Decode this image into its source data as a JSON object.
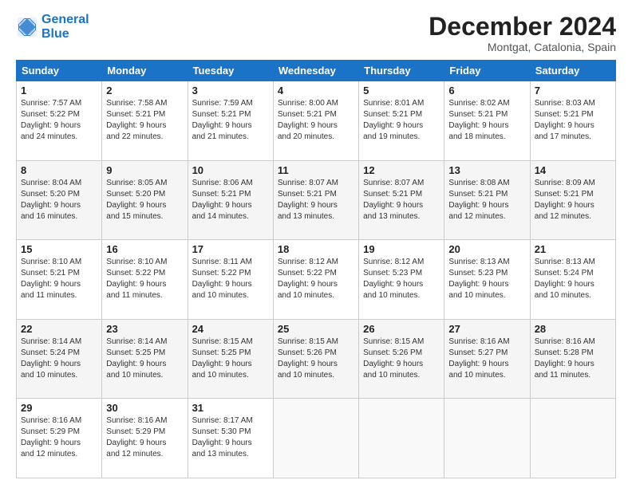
{
  "logo": {
    "line1": "General",
    "line2": "Blue"
  },
  "header": {
    "month": "December 2024",
    "location": "Montgat, Catalonia, Spain"
  },
  "days_of_week": [
    "Sunday",
    "Monday",
    "Tuesday",
    "Wednesday",
    "Thursday",
    "Friday",
    "Saturday"
  ],
  "weeks": [
    [
      {
        "day": "1",
        "info": "Sunrise: 7:57 AM\nSunset: 5:22 PM\nDaylight: 9 hours\nand 24 minutes."
      },
      {
        "day": "2",
        "info": "Sunrise: 7:58 AM\nSunset: 5:21 PM\nDaylight: 9 hours\nand 22 minutes."
      },
      {
        "day": "3",
        "info": "Sunrise: 7:59 AM\nSunset: 5:21 PM\nDaylight: 9 hours\nand 21 minutes."
      },
      {
        "day": "4",
        "info": "Sunrise: 8:00 AM\nSunset: 5:21 PM\nDaylight: 9 hours\nand 20 minutes."
      },
      {
        "day": "5",
        "info": "Sunrise: 8:01 AM\nSunset: 5:21 PM\nDaylight: 9 hours\nand 19 minutes."
      },
      {
        "day": "6",
        "info": "Sunrise: 8:02 AM\nSunset: 5:21 PM\nDaylight: 9 hours\nand 18 minutes."
      },
      {
        "day": "7",
        "info": "Sunrise: 8:03 AM\nSunset: 5:21 PM\nDaylight: 9 hours\nand 17 minutes."
      }
    ],
    [
      {
        "day": "8",
        "info": "Sunrise: 8:04 AM\nSunset: 5:20 PM\nDaylight: 9 hours\nand 16 minutes."
      },
      {
        "day": "9",
        "info": "Sunrise: 8:05 AM\nSunset: 5:20 PM\nDaylight: 9 hours\nand 15 minutes."
      },
      {
        "day": "10",
        "info": "Sunrise: 8:06 AM\nSunset: 5:21 PM\nDaylight: 9 hours\nand 14 minutes."
      },
      {
        "day": "11",
        "info": "Sunrise: 8:07 AM\nSunset: 5:21 PM\nDaylight: 9 hours\nand 13 minutes."
      },
      {
        "day": "12",
        "info": "Sunrise: 8:07 AM\nSunset: 5:21 PM\nDaylight: 9 hours\nand 13 minutes."
      },
      {
        "day": "13",
        "info": "Sunrise: 8:08 AM\nSunset: 5:21 PM\nDaylight: 9 hours\nand 12 minutes."
      },
      {
        "day": "14",
        "info": "Sunrise: 8:09 AM\nSunset: 5:21 PM\nDaylight: 9 hours\nand 12 minutes."
      }
    ],
    [
      {
        "day": "15",
        "info": "Sunrise: 8:10 AM\nSunset: 5:21 PM\nDaylight: 9 hours\nand 11 minutes."
      },
      {
        "day": "16",
        "info": "Sunrise: 8:10 AM\nSunset: 5:22 PM\nDaylight: 9 hours\nand 11 minutes."
      },
      {
        "day": "17",
        "info": "Sunrise: 8:11 AM\nSunset: 5:22 PM\nDaylight: 9 hours\nand 10 minutes."
      },
      {
        "day": "18",
        "info": "Sunrise: 8:12 AM\nSunset: 5:22 PM\nDaylight: 9 hours\nand 10 minutes."
      },
      {
        "day": "19",
        "info": "Sunrise: 8:12 AM\nSunset: 5:23 PM\nDaylight: 9 hours\nand 10 minutes."
      },
      {
        "day": "20",
        "info": "Sunrise: 8:13 AM\nSunset: 5:23 PM\nDaylight: 9 hours\nand 10 minutes."
      },
      {
        "day": "21",
        "info": "Sunrise: 8:13 AM\nSunset: 5:24 PM\nDaylight: 9 hours\nand 10 minutes."
      }
    ],
    [
      {
        "day": "22",
        "info": "Sunrise: 8:14 AM\nSunset: 5:24 PM\nDaylight: 9 hours\nand 10 minutes."
      },
      {
        "day": "23",
        "info": "Sunrise: 8:14 AM\nSunset: 5:25 PM\nDaylight: 9 hours\nand 10 minutes."
      },
      {
        "day": "24",
        "info": "Sunrise: 8:15 AM\nSunset: 5:25 PM\nDaylight: 9 hours\nand 10 minutes."
      },
      {
        "day": "25",
        "info": "Sunrise: 8:15 AM\nSunset: 5:26 PM\nDaylight: 9 hours\nand 10 minutes."
      },
      {
        "day": "26",
        "info": "Sunrise: 8:15 AM\nSunset: 5:26 PM\nDaylight: 9 hours\nand 10 minutes."
      },
      {
        "day": "27",
        "info": "Sunrise: 8:16 AM\nSunset: 5:27 PM\nDaylight: 9 hours\nand 10 minutes."
      },
      {
        "day": "28",
        "info": "Sunrise: 8:16 AM\nSunset: 5:28 PM\nDaylight: 9 hours\nand 11 minutes."
      }
    ],
    [
      {
        "day": "29",
        "info": "Sunrise: 8:16 AM\nSunset: 5:29 PM\nDaylight: 9 hours\nand 12 minutes."
      },
      {
        "day": "30",
        "info": "Sunrise: 8:16 AM\nSunset: 5:29 PM\nDaylight: 9 hours\nand 12 minutes."
      },
      {
        "day": "31",
        "info": "Sunrise: 8:17 AM\nSunset: 5:30 PM\nDaylight: 9 hours\nand 13 minutes."
      },
      null,
      null,
      null,
      null
    ]
  ]
}
